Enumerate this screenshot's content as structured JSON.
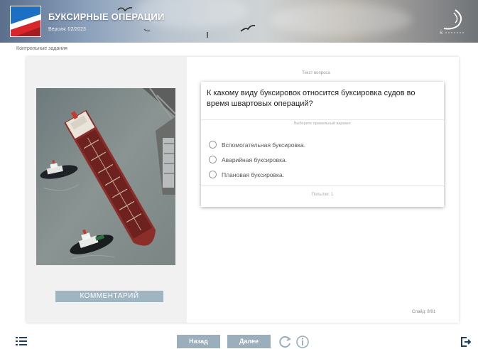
{
  "header": {
    "title": "БУКСИРНЫЕ ОПЕРАЦИИ",
    "version": "Версия: 02/2023",
    "logo_icon": "ship-bow-logo",
    "brand_icon": "brand-ship-logo"
  },
  "breadcrumb": "Контрольные задания",
  "left_panel": {
    "image_icon": "tanker-tugboats-photo",
    "comment_label": "КОММЕНТАРИЙ"
  },
  "question": {
    "label": "Текст вопроса",
    "text": "К какому виду буксировок относится буксировка судов во время швартовых операций?",
    "hint": "Выберите правильный вариант",
    "answers": [
      "Вспомогательная буксировка.",
      "Аварийная буксировка.",
      "Плановая буксировка."
    ],
    "attempts": "Попытки: 1"
  },
  "slide_counter": "Слайд: 8/91",
  "footer": {
    "back_label": "Назад",
    "next_label": "Далее",
    "menu_icon": "list-menu-icon",
    "refresh_icon": "refresh-icon",
    "info_icon": "info-icon",
    "exit_icon": "exit-icon"
  },
  "colors": {
    "accent": "#9aaebc",
    "icon_dark": "#1f3e66"
  }
}
